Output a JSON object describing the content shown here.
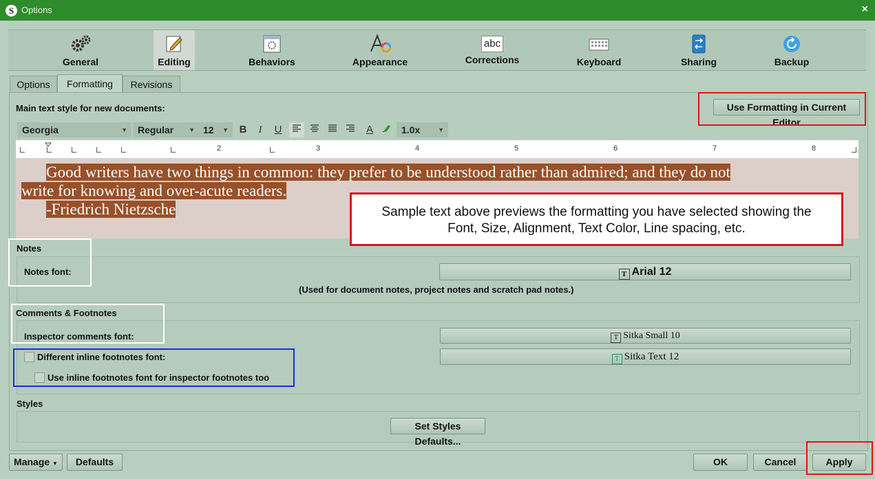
{
  "window": {
    "title": "Options",
    "app_icon": "S",
    "close_glyph": "×"
  },
  "toolbar": [
    {
      "label": "General",
      "icon": "gears-icon"
    },
    {
      "label": "Editing",
      "icon": "edit-icon",
      "active": true
    },
    {
      "label": "Behaviors",
      "icon": "behaviors-icon"
    },
    {
      "label": "Appearance",
      "icon": "appearance-icon"
    },
    {
      "label": "Corrections",
      "icon": "abc-icon",
      "icon_text": "abc"
    },
    {
      "label": "Keyboard",
      "icon": "keyboard-icon"
    },
    {
      "label": "Sharing",
      "icon": "sharing-icon"
    },
    {
      "label": "Backup",
      "icon": "backup-icon"
    }
  ],
  "tabs": [
    "Options",
    "Formatting",
    "Revisions"
  ],
  "active_tab": "Formatting",
  "main_style": {
    "label": "Main text style for new documents:",
    "use_current_button": "Use Formatting in Current Editor",
    "font": "Georgia",
    "style": "Regular",
    "size": "12",
    "bold": "B",
    "italic": "I",
    "underline": "U",
    "text_color_glyph": "A",
    "line_spacing": "1.0x"
  },
  "ruler_numbers": [
    "2",
    "3",
    "4",
    "5",
    "6",
    "7",
    "8"
  ],
  "preview": {
    "line1": "Good writers have two things in common: they prefer to be understood rather than admired; and they do not",
    "line2": "write for knowing and over-acute readers.",
    "line3": "-Friedrich Nietzsche",
    "highlight_color": "#98512a"
  },
  "annotation": {
    "line1": "Sample text above previews the formatting you have selected showing the",
    "line2": "Font, Size, Alignment, Text Color, Line spacing, etc."
  },
  "notes": {
    "heading": "Notes",
    "font_label": "Notes font:",
    "font_button": "Arial 12",
    "hint": "(Used for document notes, project notes and scratch pad notes.)"
  },
  "comments": {
    "heading": "Comments & Footnotes",
    "inspector_label": "Inspector comments font:",
    "inspector_button": "Sitka Small 10",
    "footnote_button": "Sitka Text 12",
    "different_inline": "Different inline footnotes font:",
    "use_inline_for_inspector": "Use inline footnotes font for inspector footnotes too"
  },
  "styles": {
    "heading": "Styles",
    "button": "Set Styles Defaults..."
  },
  "bottom": {
    "manage": "Manage",
    "defaults": "Defaults",
    "ok": "OK",
    "cancel": "Cancel",
    "apply": "Apply"
  },
  "colors": {
    "title_bar": "#2e8c2c",
    "highlight_red": "#e0141b",
    "highlight_blue": "#1330e0"
  }
}
